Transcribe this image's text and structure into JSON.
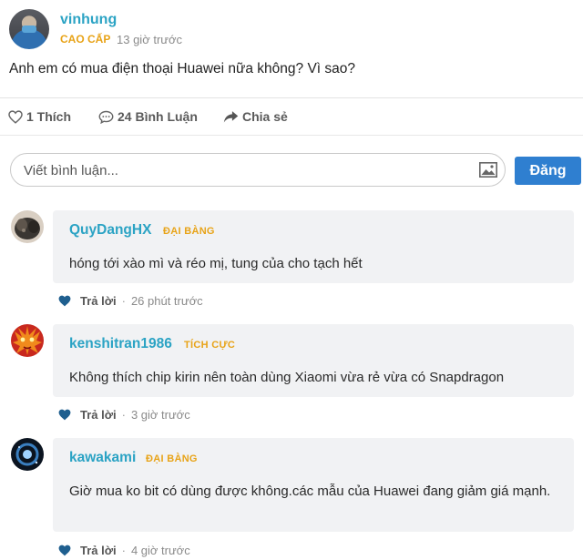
{
  "post": {
    "author": "vinhung",
    "rank": "CAO CẤP",
    "time": "13 giờ trước",
    "content": "Anh em có mua điện thoại Huawei nữa không? Vì sao?"
  },
  "actions": {
    "like_label": "1 Thích",
    "comment_label": "24 Bình Luận",
    "share_label": "Chia sẻ"
  },
  "composer": {
    "placeholder": "Viết bình luận...",
    "post_label": "Đăng"
  },
  "comments": [
    {
      "name": "QuyDangHX",
      "badge": "ĐẠI BÀNG",
      "text": "hóng tới xào mì và réo mị, tung của cho tạch hết",
      "reply_label": "Trả lời",
      "separator": "·",
      "time": "26 phút trước"
    },
    {
      "name": "kenshitran1986",
      "badge": "TÍCH CỰC",
      "text": "Không thích chip kirin nên toàn dùng Xiaomi vừa rẻ vừa có Snapdragon",
      "reply_label": "Trả lời",
      "separator": "·",
      "time": "3 giờ trước"
    },
    {
      "name": "kawakami",
      "badge": "ĐẠI BÀNG",
      "text": "Giờ mua ko bit có dùng được không.các mẫu của Huawei đang giảm giá mạnh.",
      "reply_label": "Trả lời",
      "separator": "·",
      "time": "4 giờ trước"
    }
  ],
  "colors": {
    "name": "#2ba3c4",
    "badge": "#e8a317",
    "button": "#2f7fd0",
    "heart": "#1f5f8f",
    "bubble": "#f1f2f4"
  }
}
